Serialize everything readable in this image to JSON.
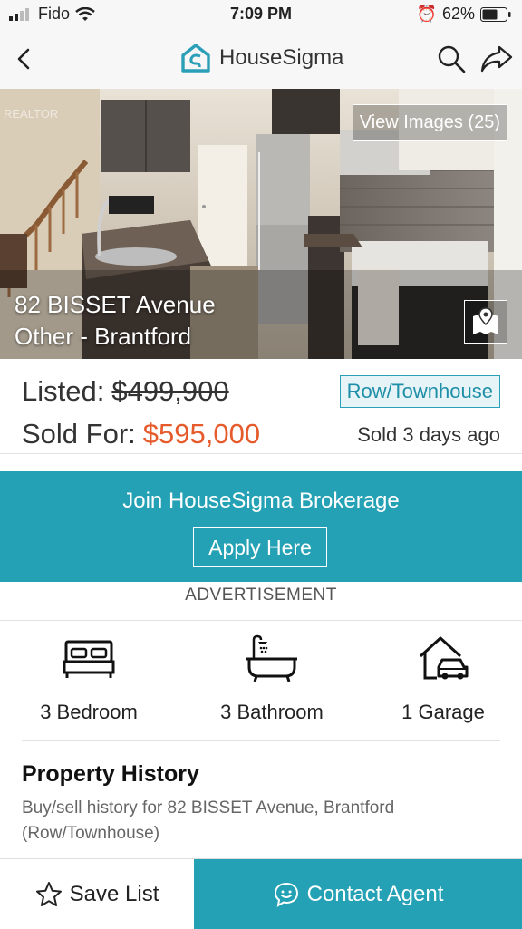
{
  "status_bar": {
    "carrier": "Fido",
    "time": "7:09 PM",
    "battery": "62%"
  },
  "header": {
    "app_name": "HouseSigma",
    "back_icon": "chevron-left-icon",
    "search_icon": "search-icon",
    "share_icon": "share-icon"
  },
  "hero": {
    "view_images_label": "View Images (25)",
    "address_line1": "82 BISSET Avenue",
    "address_line2": "Other - Brantford",
    "watermark": "REALTOR",
    "map_icon": "map-pin-icon"
  },
  "price": {
    "listed_label": "Listed:",
    "listed_value": "$499,900",
    "sold_label": "Sold For:",
    "sold_value": "$595,000",
    "type_badge": "Row/Townhouse",
    "sold_ago": "Sold 3 days ago"
  },
  "banner": {
    "title": "Join HouseSigma Brokerage",
    "button": "Apply Here",
    "ad_label": "ADVERTISEMENT"
  },
  "features": [
    {
      "label": "3 Bedroom",
      "icon": "bed-icon"
    },
    {
      "label": "3 Bathroom",
      "icon": "bathtub-icon"
    },
    {
      "label": "1 Garage",
      "icon": "garage-icon"
    }
  ],
  "history": {
    "title": "Property History",
    "description": "Buy/sell history for 82 BISSET Avenue, Brantford (Row/Townhouse)"
  },
  "bottom_bar": {
    "save_label": "Save List",
    "contact_label": "Contact Agent"
  },
  "colors": {
    "accent": "#24a1b4",
    "sold_price": "#e65b2c"
  }
}
